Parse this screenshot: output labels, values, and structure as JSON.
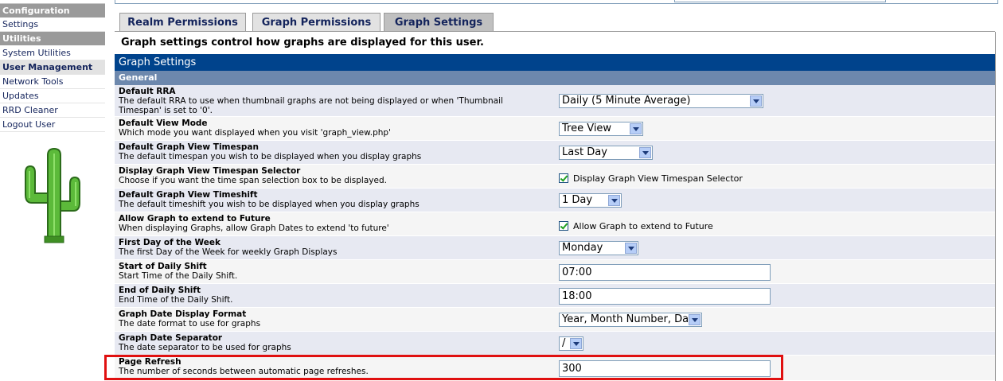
{
  "sidebar": {
    "sections": [
      {
        "heading": "Configuration",
        "items": [
          "Settings"
        ]
      },
      {
        "heading": "Utilities",
        "items": [
          "System Utilities",
          "User Management",
          "Network Tools",
          "Updates",
          "RRD Cleaner",
          "Logout User"
        ]
      }
    ],
    "selected": "User Management",
    "logo_icon": "cactus-icon"
  },
  "tabs": [
    {
      "label": "Realm Permissions",
      "active": false
    },
    {
      "label": "Graph Permissions",
      "active": false
    },
    {
      "label": "Graph Settings",
      "active": true
    }
  ],
  "description": "Graph settings control how graphs are displayed for this user.",
  "panel": {
    "title": "Graph Settings",
    "section": "General",
    "rows": [
      {
        "title": "Default RRA",
        "desc": "The default RRA to use when thumbnail graphs are not being displayed or when 'Thumbnail Timespan' is set to '0'.",
        "control": "select",
        "value": "Daily (5 Minute Average)"
      },
      {
        "title": "Default View Mode",
        "desc": "Which mode you want displayed when you visit 'graph_view.php'",
        "control": "select",
        "value": "Tree View"
      },
      {
        "title": "Default Graph View Timespan",
        "desc": "The default timespan you wish to be displayed when you display graphs",
        "control": "select",
        "value": "Last Day"
      },
      {
        "title": "Display Graph View Timespan Selector",
        "desc": "Choose if you want the time span selection box to be displayed.",
        "control": "checkbox",
        "value": "Display Graph View Timespan Selector",
        "checked": true
      },
      {
        "title": "Default Graph View Timeshift",
        "desc": "The default timeshift you wish to be displayed when you display graphs",
        "control": "select",
        "value": "1 Day"
      },
      {
        "title": "Allow Graph to extend to Future",
        "desc": "When displaying Graphs, allow Graph Dates to extend 'to future'",
        "control": "checkbox",
        "value": "Allow Graph to extend to Future",
        "checked": true
      },
      {
        "title": "First Day of the Week",
        "desc": "The first Day of the Week for weekly Graph Displays",
        "control": "select",
        "value": "Monday"
      },
      {
        "title": "Start of Daily Shift",
        "desc": "Start Time of the Daily Shift.",
        "control": "text",
        "value": "07:00"
      },
      {
        "title": "End of Daily Shift",
        "desc": "End Time of the Daily Shift.",
        "control": "text",
        "value": "18:00"
      },
      {
        "title": "Graph Date Display Format",
        "desc": "The date format to use for graphs",
        "control": "select",
        "value": "Year, Month Number, Day"
      },
      {
        "title": "Graph Date Separator",
        "desc": "The date separator to be used for graphs",
        "control": "select",
        "value": "/"
      },
      {
        "title": "Page Refresh",
        "desc": "The number of seconds between automatic page refreshes.",
        "control": "text",
        "value": "300"
      }
    ]
  },
  "colors": {
    "header": "#00438c",
    "section": "#6d88ad",
    "highlight": "#e01010"
  }
}
